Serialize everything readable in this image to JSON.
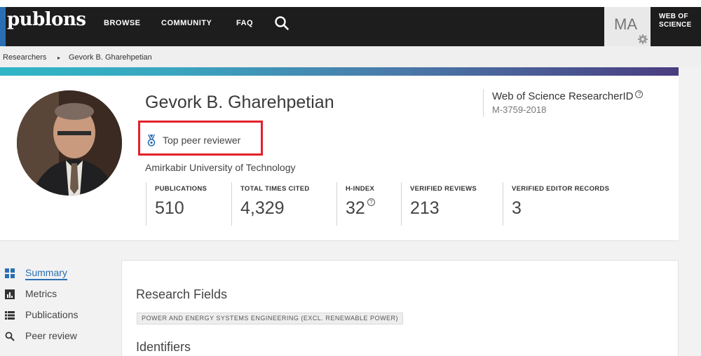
{
  "nav": {
    "logo": "publons",
    "links": [
      "BROWSE",
      "COMMUNITY",
      "FAQ"
    ],
    "avatar_initials": "MA",
    "wos_line1": "WEB OF",
    "wos_line2": "SCIENCE"
  },
  "breadcrumb": {
    "root": "Researchers",
    "separator": "▸",
    "current": "Gevork B. Gharehpetian"
  },
  "profile": {
    "name": "Gevork B. Gharehpetian",
    "badge": "Top peer reviewer",
    "affiliation": "Amirkabir University of Technology",
    "researcher_id_label": "Web of Science ResearcherID",
    "researcher_id": "M-3759-2018",
    "help_glyph": "?",
    "metrics": [
      {
        "label": "PUBLICATIONS",
        "value": "510"
      },
      {
        "label": "TOTAL TIMES CITED",
        "value": "4,329"
      },
      {
        "label": "H-INDEX",
        "value": "32"
      },
      {
        "label": "VERIFIED REVIEWS",
        "value": "213"
      },
      {
        "label": "VERIFIED EDITOR RECORDS",
        "value": "3"
      }
    ]
  },
  "sidebar": {
    "items": [
      {
        "label": "Summary",
        "icon": "summary-grid-icon",
        "active": true
      },
      {
        "label": "Metrics",
        "icon": "bar-chart-icon",
        "active": false
      },
      {
        "label": "Publications",
        "icon": "list-icon",
        "active": false
      },
      {
        "label": "Peer review",
        "icon": "search-icon",
        "active": false
      }
    ]
  },
  "main": {
    "research_fields_title": "Research Fields",
    "research_field_tag": "POWER AND ENERGY SYSTEMS ENGINEERING (EXCL. RENEWABLE POWER)",
    "identifiers_title": "Identifiers"
  },
  "colors": {
    "nav_bg": "#1d1d1d",
    "accent_blue": "#2a6fb3",
    "highlight_red": "#e3212b",
    "gradient_start": "#2fb6c6",
    "gradient_end": "#4a3d80"
  }
}
